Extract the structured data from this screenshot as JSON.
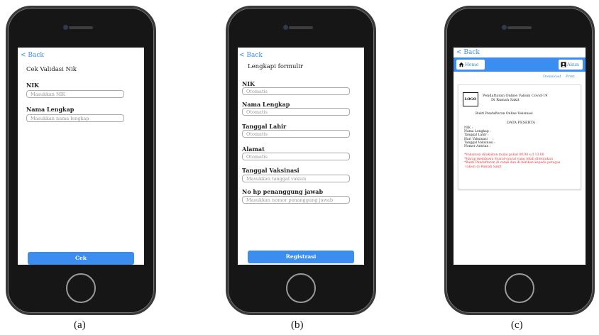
{
  "captions": [
    "(a)",
    "(b)",
    "(c)"
  ],
  "phone_a": {
    "back": "< Back",
    "title": "Cek Validasi Nik",
    "fields": [
      {
        "label": "NIK",
        "placeholder": "Masukkan NIK"
      },
      {
        "label": "Nama Lengkap",
        "placeholder": "Masukkan nama lengkap"
      }
    ],
    "button": "Cek"
  },
  "phone_b": {
    "back": "< Back",
    "title": "Lengkapi formulir",
    "fields": [
      {
        "label": "NIK",
        "placeholder": "Otomatis"
      },
      {
        "label": "Nama Lengkap",
        "placeholder": "Otomatis"
      },
      {
        "label": "Tanggal Lahir",
        "placeholder": "Otomatis"
      },
      {
        "label": "Alamat",
        "placeholder": "Otomatis"
      },
      {
        "label": "Tanggal Vaksinasi",
        "placeholder": "Masukkan tanggal vaksin"
      },
      {
        "label": "No hp penanggung jawab",
        "placeholder": "Masukkan nomor penanggung jawab"
      }
    ],
    "button": "Registrasi"
  },
  "phone_c": {
    "back": "< Back",
    "home": "Home",
    "akun": "Akun",
    "download": "Download",
    "print": "Print",
    "logo": "LOGO",
    "heading1": "Pendaftaran Online Vaksin Covid-19",
    "heading2": "Di Rumah Sakit",
    "subheading": "Bukti Pendaftaran Online Vaksinasi",
    "data_title": "DATA PESERTA",
    "rows": [
      "NIK :",
      "Nama Lengkap :",
      "Tanggal Lahir :",
      "Hari Vaksinasi     :",
      "Tanggal Vaksinasi :",
      "Nomor Antrian :"
    ],
    "notes": [
      "*Vaksinasi dilakukan mulai pukul 08.00 s.d 13.00",
      "*Harap membawa Syarat-syarat yang telah ditentukan",
      "*Bukti Pendaftaran di cetak dan di berikan kepada petugas",
      " vaksin di Rumah Sakit"
    ]
  },
  "colors": {
    "accent": "#3b8ef0",
    "warning": "#e23a3a"
  }
}
